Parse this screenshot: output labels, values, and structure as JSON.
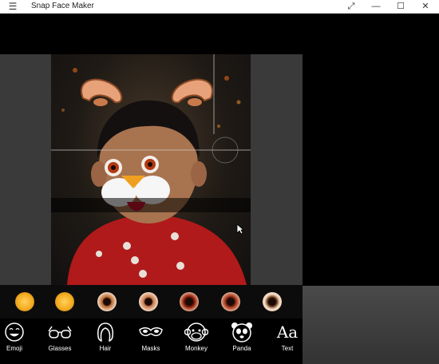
{
  "window": {
    "title": "Snap Face Maker",
    "menu_icon": "hamburger-icon",
    "controls": [
      "fullscreen-icon",
      "minimize-icon",
      "maximize-icon",
      "close-icon"
    ]
  },
  "eyes": [
    {
      "name": "eye-yellow-1",
      "color": "#f2a81d"
    },
    {
      "name": "eye-yellow-2",
      "color": "#f2a81d"
    },
    {
      "name": "eye-brown-1",
      "color": "#b8672e"
    },
    {
      "name": "eye-brown-2",
      "color": "#c8764a"
    },
    {
      "name": "eye-red-1",
      "color": "#8f1c0b"
    },
    {
      "name": "eye-red-2",
      "color": "#a0301a"
    },
    {
      "name": "eye-white",
      "color": "#f3d9c2"
    }
  ],
  "categories": [
    {
      "label": "Emoji",
      "icon": "smiley-icon"
    },
    {
      "label": "Glasses",
      "icon": "glasses-icon"
    },
    {
      "label": "Hair",
      "icon": "hair-icon"
    },
    {
      "label": "Masks",
      "icon": "mask-icon"
    },
    {
      "label": "Monkey",
      "icon": "monkey-icon"
    },
    {
      "label": "Panda",
      "icon": "panda-icon"
    },
    {
      "label": "Text",
      "icon": "text-icon",
      "glyph": "Aa"
    }
  ]
}
